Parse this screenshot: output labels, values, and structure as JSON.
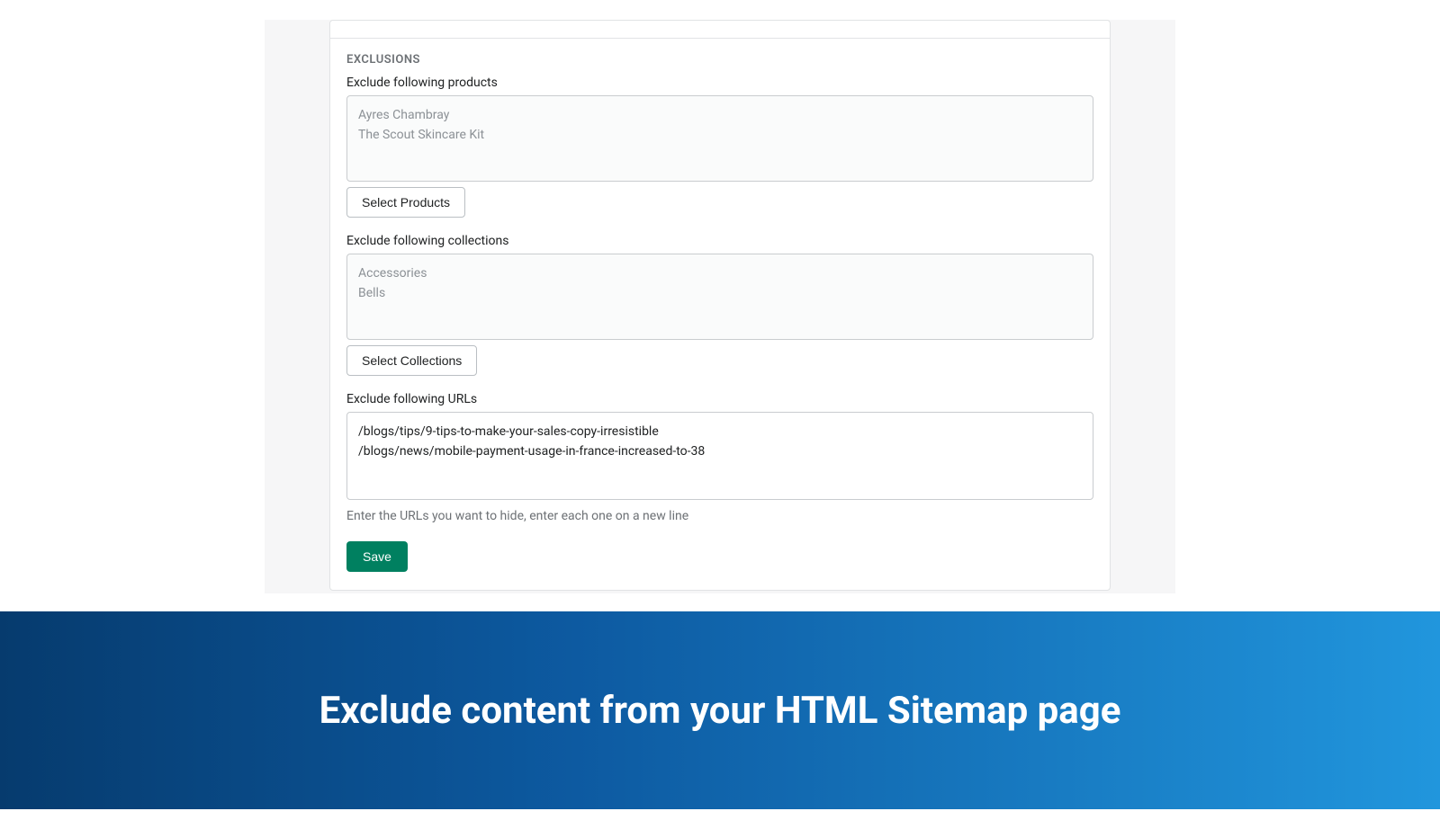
{
  "exclusions": {
    "sectionTitle": "EXCLUSIONS",
    "products": {
      "label": "Exclude following products",
      "items": [
        "Ayres Chambray",
        "The Scout Skincare Kit"
      ],
      "button": "Select Products"
    },
    "collections": {
      "label": "Exclude following collections",
      "items": [
        "Accessories",
        "Bells"
      ],
      "button": "Select Collections"
    },
    "urls": {
      "label": "Exclude following URLs",
      "value": "/blogs/tips/9-tips-to-make-your-sales-copy-irresistible\n/blogs/news/mobile-payment-usage-in-france-increased-to-38",
      "help": "Enter the URLs you want to hide, enter each one on a new line"
    },
    "saveButton": "Save"
  },
  "banner": {
    "headline": "Exclude content from your HTML Sitemap page"
  }
}
